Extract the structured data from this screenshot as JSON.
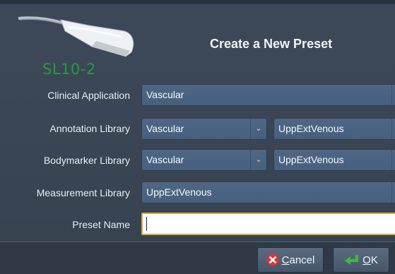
{
  "dialog": {
    "title": "Create a New Preset",
    "probe_label": "SL10-2"
  },
  "form": {
    "clinical_application": {
      "label": "Clinical Application",
      "value": "Vascular"
    },
    "annotation_library": {
      "label": "Annotation Library",
      "value": "Vascular",
      "sub_value": "UppExtVenous"
    },
    "bodymarker_library": {
      "label": "Bodymarker Library",
      "value": "Vascular",
      "sub_value": "UppExtVenous"
    },
    "measurement_library": {
      "label": "Measurement Library",
      "value": "UppExtVenous"
    },
    "preset_name": {
      "label": "Preset Name",
      "value": ""
    }
  },
  "buttons": {
    "cancel_first": "C",
    "cancel_rest": "ancel",
    "ok_first": "O",
    "ok_rest": "K"
  },
  "colors": {
    "probe_label": "#1f9e3a",
    "combo_bg": "#4f6684",
    "focus_border": "#d8a64a",
    "cancel_icon": "#e03434",
    "ok_icon": "#3fb83c"
  },
  "icons": {
    "probe": "ultrasound-probe-icon",
    "cancel": "red-x-icon",
    "ok": "green-return-arrow-icon",
    "dropdown": "chevron-down-icon"
  }
}
